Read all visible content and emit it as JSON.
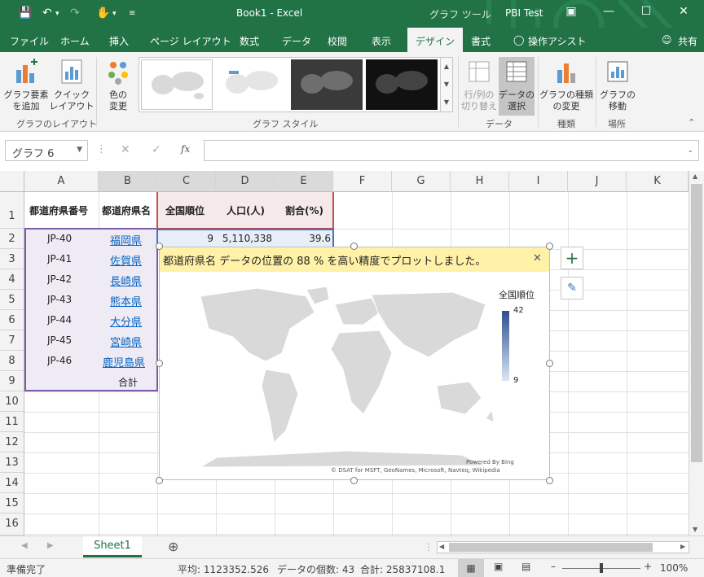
{
  "titlebar": {
    "doc_title": "Book1  -  Excel",
    "context_tool": "グラフ ツール",
    "account": "PBI Test",
    "icons": [
      "save-icon",
      "undo-icon",
      "redo-icon",
      "touch-mode-icon",
      "customize-qat-icon",
      "ribbon-display-icon",
      "minimize-icon",
      "maximize-icon",
      "close-icon"
    ]
  },
  "tabs": {
    "items": [
      "ファイル",
      "ホーム",
      "挿入",
      "ページ レイアウト",
      "数式",
      "データ",
      "校閲",
      "表示",
      "デザイン",
      "書式"
    ],
    "active": "デザイン",
    "tell_me": "操作アシスト",
    "share": "共有"
  },
  "ribbon": {
    "add_element": [
      "グラフ要素",
      "を追加"
    ],
    "quick_layout": [
      "クイック",
      "レイアウト"
    ],
    "change_colors": [
      "色の",
      "変更"
    ],
    "group_layout": "グラフのレイアウト",
    "group_styles": "グラフ スタイル",
    "switch_rowcol": [
      "行/列の",
      "切り替え"
    ],
    "select_data": [
      "データの",
      "選択"
    ],
    "group_data": "データ",
    "change_type": [
      "グラフの種類",
      "の変更"
    ],
    "group_type": "種類",
    "move_chart": [
      "グラフの",
      "移動"
    ],
    "group_location": "場所"
  },
  "formula_bar": {
    "name_box": "グラフ 6",
    "fx_label": "fx",
    "formula": ""
  },
  "columns": [
    "A",
    "B",
    "C",
    "D",
    "E",
    "F",
    "G",
    "H",
    "I",
    "J",
    "K"
  ],
  "rows": [
    "1",
    "2",
    "3",
    "4",
    "5",
    "6",
    "7",
    "8",
    "9",
    "10",
    "11",
    "12",
    "13",
    "14",
    "15",
    "16"
  ],
  "table": {
    "headers": [
      "都道府県番号",
      "都道府県名",
      "全国順位",
      "人口(人)",
      "割合(%)"
    ],
    "codes": [
      "JP-40",
      "JP-41",
      "JP-42",
      "JP-43",
      "JP-44",
      "JP-45",
      "JP-46"
    ],
    "names": [
      "福岡県",
      "佐賀県",
      "長崎県",
      "熊本県",
      "大分県",
      "宮崎県",
      "鹿児島県"
    ],
    "total_label": "合計",
    "row2": {
      "rank": "9",
      "population": "5,110,338",
      "ratio": "39.6"
    }
  },
  "chart": {
    "banner": "都道府県名 データの位置の 88 % を高い精度でプロットしました。",
    "legend_title": "全国順位",
    "legend_max": "42",
    "legend_min": "9",
    "credit1": "Powered By Bing",
    "credit2": "© DSAT for MSFT, GeoNames, Microsoft, Navteq, Wikipedia",
    "colors": {
      "scale_high": "#2f4d8f",
      "scale_low": "#dce6f5",
      "land": "#d9d9d9",
      "banner": "#fff2a8"
    }
  },
  "sheets": {
    "active": "Sheet1"
  },
  "status": {
    "ready": "準備完了",
    "average": "平均: 1123352.526",
    "count": "データの個数: 43",
    "sum": "合計: 25837108.1",
    "zoom": "100%"
  }
}
